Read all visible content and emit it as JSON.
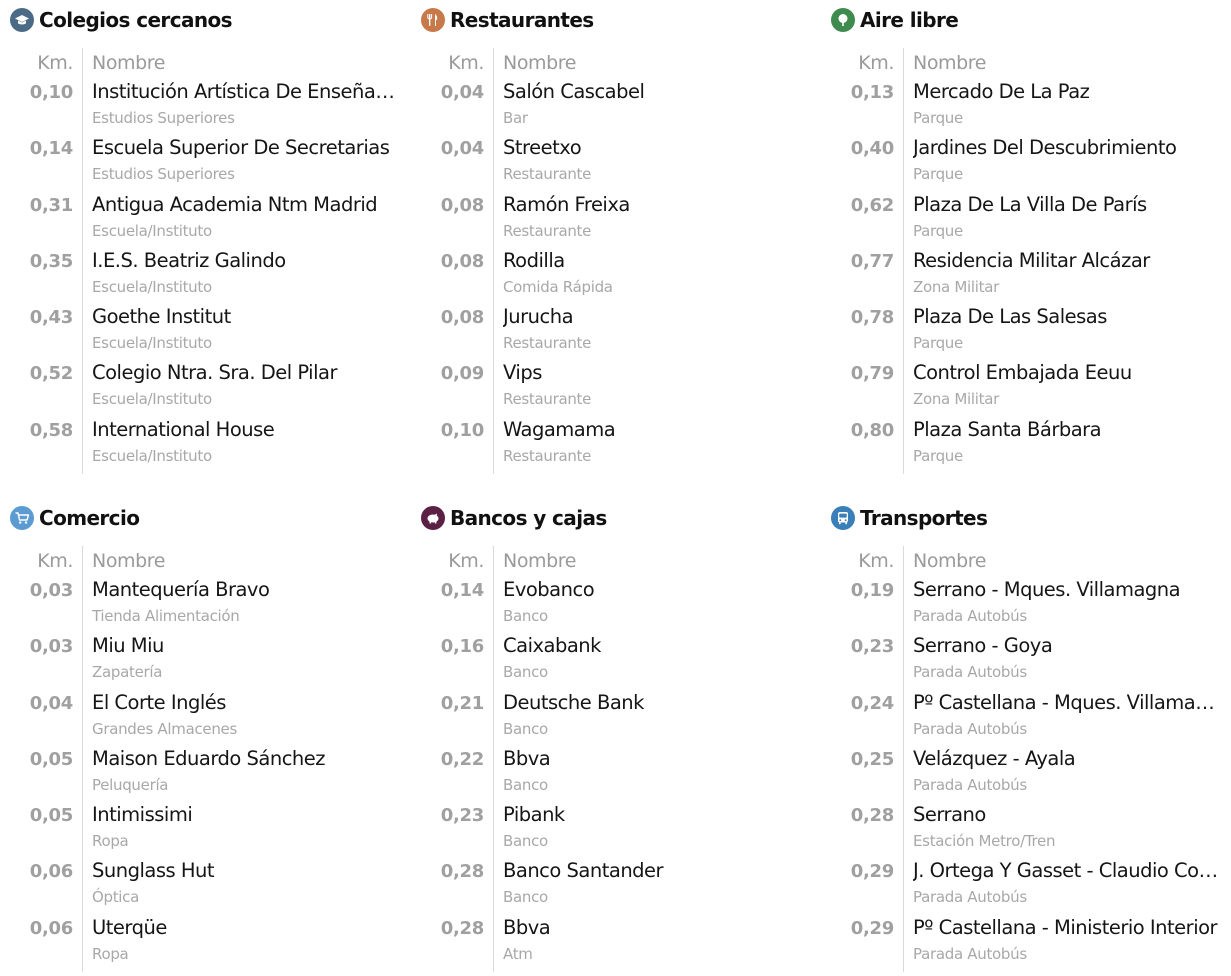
{
  "headers": {
    "km": "Km.",
    "name": "Nombre"
  },
  "sections": [
    {
      "title": "Colegios cercanos",
      "icon": "graduation-cap-icon",
      "icon_color": "#4a6a86",
      "rows": [
        {
          "km": "0,10",
          "name": "Institución Artística De Enseñanz...",
          "type": "Estudios Superiores"
        },
        {
          "km": "0,14",
          "name": "Escuela Superior De Secretarias",
          "type": "Estudios Superiores"
        },
        {
          "km": "0,31",
          "name": "Antigua Academia Ntm Madrid",
          "type": "Escuela/Instituto"
        },
        {
          "km": "0,35",
          "name": "I.E.S. Beatriz Galindo",
          "type": "Escuela/Instituto"
        },
        {
          "km": "0,43",
          "name": "Goethe Institut",
          "type": "Escuela/Instituto"
        },
        {
          "km": "0,52",
          "name": "Colegio Ntra. Sra. Del Pilar",
          "type": "Escuela/Instituto"
        },
        {
          "km": "0,58",
          "name": "International House",
          "type": "Escuela/Instituto"
        }
      ]
    },
    {
      "title": "Restaurantes",
      "icon": "fork-knife-icon",
      "icon_color": "#c8794a",
      "rows": [
        {
          "km": "0,04",
          "name": "Salón Cascabel",
          "type": "Bar"
        },
        {
          "km": "0,04",
          "name": "Streetxo",
          "type": "Restaurante"
        },
        {
          "km": "0,08",
          "name": "Ramón Freixa",
          "type": "Restaurante"
        },
        {
          "km": "0,08",
          "name": "Rodilla",
          "type": "Comida Rápida"
        },
        {
          "km": "0,08",
          "name": "Jurucha",
          "type": "Restaurante"
        },
        {
          "km": "0,09",
          "name": "Vips",
          "type": "Restaurante"
        },
        {
          "km": "0,10",
          "name": "Wagamama",
          "type": "Restaurante"
        }
      ]
    },
    {
      "title": "Aire libre",
      "icon": "tree-icon",
      "icon_color": "#3e8a4f",
      "rows": [
        {
          "km": "0,13",
          "name": "Mercado De La Paz",
          "type": "Parque"
        },
        {
          "km": "0,40",
          "name": "Jardines Del Descubrimiento",
          "type": "Parque"
        },
        {
          "km": "0,62",
          "name": "Plaza De La Villa De París",
          "type": "Parque"
        },
        {
          "km": "0,77",
          "name": "Residencia Militar Alcázar",
          "type": "Zona Militar"
        },
        {
          "km": "0,78",
          "name": "Plaza De Las Salesas",
          "type": "Parque"
        },
        {
          "km": "0,79",
          "name": "Control Embajada Eeuu",
          "type": "Zona Militar"
        },
        {
          "km": "0,80",
          "name": "Plaza Santa Bárbara",
          "type": "Parque"
        }
      ]
    },
    {
      "title": "Comercio",
      "icon": "shopping-cart-icon",
      "icon_color": "#5b9bd1",
      "rows": [
        {
          "km": "0,03",
          "name": "Mantequería Bravo",
          "type": "Tienda Alimentación"
        },
        {
          "km": "0,03",
          "name": "Miu Miu",
          "type": "Zapatería"
        },
        {
          "km": "0,04",
          "name": "El Corte Inglés",
          "type": "Grandes Almacenes"
        },
        {
          "km": "0,05",
          "name": "Maison Eduardo Sánchez",
          "type": "Peluquería"
        },
        {
          "km": "0,05",
          "name": "Intimissimi",
          "type": "Ropa"
        },
        {
          "km": "0,06",
          "name": "Sunglass Hut",
          "type": "Óptica"
        },
        {
          "km": "0,06",
          "name": "Uterqüe",
          "type": "Ropa"
        }
      ]
    },
    {
      "title": "Bancos y cajas",
      "icon": "piggy-bank-icon",
      "icon_color": "#5a2145",
      "rows": [
        {
          "km": "0,14",
          "name": "Evobanco",
          "type": "Banco"
        },
        {
          "km": "0,16",
          "name": "Caixabank",
          "type": "Banco"
        },
        {
          "km": "0,21",
          "name": "Deutsche Bank",
          "type": "Banco"
        },
        {
          "km": "0,22",
          "name": "Bbva",
          "type": "Banco"
        },
        {
          "km": "0,23",
          "name": "Pibank",
          "type": "Banco"
        },
        {
          "km": "0,28",
          "name": "Banco Santander",
          "type": "Banco"
        },
        {
          "km": "0,28",
          "name": "Bbva",
          "type": "Atm"
        }
      ]
    },
    {
      "title": "Transportes",
      "icon": "bus-icon",
      "icon_color": "#3a7fb8",
      "rows": [
        {
          "km": "0,19",
          "name": "Serrano - Mques. Villamagna",
          "type": "Parada Autobús"
        },
        {
          "km": "0,23",
          "name": "Serrano - Goya",
          "type": "Parada Autobús"
        },
        {
          "km": "0,24",
          "name": "Pº Castellana - Mques. Villamagn...",
          "type": "Parada Autobús"
        },
        {
          "km": "0,25",
          "name": "Velázquez - Ayala",
          "type": "Parada Autobús"
        },
        {
          "km": "0,28",
          "name": "Serrano",
          "type": "Estación Metro/Tren"
        },
        {
          "km": "0,29",
          "name": "J. Ortega Y Gasset - Claudio Coel...",
          "type": "Parada Autobús"
        },
        {
          "km": "0,29",
          "name": "Pº Castellana - Ministerio Interior",
          "type": "Parada Autobús"
        }
      ]
    }
  ]
}
